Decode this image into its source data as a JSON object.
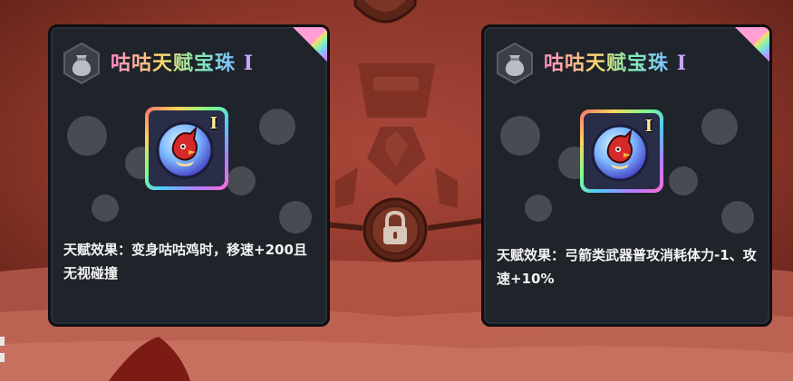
{
  "cards": [
    {
      "title": "咕咕天赋宝珠",
      "tier": "I",
      "item_tier": "I",
      "description": "天赋效果：变身咕咕鸡时，移速+200且无视碰撞"
    },
    {
      "title": "咕咕天赋宝珠",
      "tier": "I",
      "item_tier": "I",
      "description": "天赋效果：弓箭类武器普攻消耗体力-1、攻速+10%"
    }
  ],
  "icons": {
    "badge": "bag-icon",
    "lock": "lock-icon",
    "item": "chicken-orb-icon"
  },
  "colors": {
    "background": "#8e3a2a",
    "card": "#1f232a",
    "text": "#f3f3f3"
  }
}
